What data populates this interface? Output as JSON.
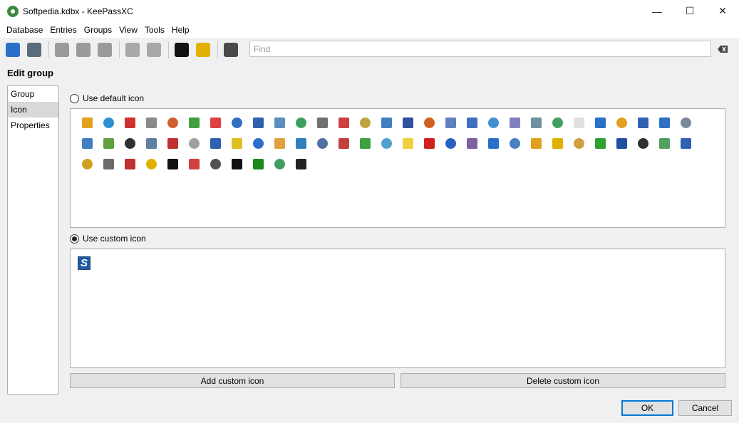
{
  "window": {
    "title": "Softpedia.kdbx - KeePassXC",
    "minimize": "—",
    "maximize": "☐",
    "close": "✕"
  },
  "menu": [
    "Database",
    "Entries",
    "Groups",
    "View",
    "Tools",
    "Help"
  ],
  "toolbar": {
    "icons": [
      {
        "name": "open-database-icon",
        "color": "#2a6fc9"
      },
      {
        "name": "save-database-icon",
        "color": "#5a6b7a"
      },
      {
        "sep": true
      },
      {
        "name": "add-entry-icon",
        "color": "#9a9a9a"
      },
      {
        "name": "edit-entry-icon",
        "color": "#9a9a9a"
      },
      {
        "name": "delete-entry-icon",
        "color": "#9a9a9a"
      },
      {
        "sep": true
      },
      {
        "name": "copy-username-icon",
        "color": "#a8a8a8"
      },
      {
        "name": "copy-password-icon",
        "color": "#a8a8a8"
      },
      {
        "sep": true
      },
      {
        "name": "password-generator-icon",
        "color": "#111111"
      },
      {
        "name": "lock-database-icon",
        "color": "#e2b100"
      },
      {
        "sep": true
      },
      {
        "name": "search-options-icon",
        "color": "#4a4a4a"
      }
    ],
    "search_placeholder": "Find"
  },
  "page_title": "Edit group",
  "sidebar": {
    "items": [
      "Group",
      "Icon",
      "Properties"
    ],
    "selected": "Icon"
  },
  "default_icon": {
    "label": "Use default icon",
    "selected": false,
    "icons": [
      "#e0a020",
      "#2f8fd0",
      "#d03030",
      "#8a8a8a",
      "#d06030",
      "#40a040",
      "#e04040",
      "#3070c0",
      "#3060b0",
      "#5a8fc0",
      "#40a060",
      "#707070",
      "#d04040",
      "#c0a040",
      "#4080c0",
      "#3050a0",
      "#d06020",
      "#6080c0",
      "#4070c0",
      "#4090d0",
      "#8080c0",
      "#7090a0",
      "#40a060",
      "#e0e0e0",
      "#2a6fc9",
      "#e0a020",
      "#3060b0",
      "#3070c0",
      "#7a8a9a",
      "#4080c0",
      "#60a040",
      "#303030",
      "#6080a0",
      "#c03030",
      "#a0a0a0",
      "#3060b0",
      "#e0c020",
      "#2a6fc9",
      "#e0a040",
      "#3080c0",
      "#5070a0",
      "#c04040",
      "#40a040",
      "#50a0d0",
      "#f0d040",
      "#d02020",
      "#2a60c0",
      "#8060a0",
      "#2a6fc9",
      "#4a80c0",
      "#e0a020",
      "#e0b000",
      "#d0a040",
      "#30a030",
      "#2050a0",
      "#303030",
      "#50a060",
      "#3060b0",
      "#d0a020",
      "#6a6a6a",
      "#c03030",
      "#e0b000",
      "#111111",
      "#d04040",
      "#505050",
      "#111111",
      "#1a8a1a",
      "#40a060",
      "#222222"
    ]
  },
  "custom_icon": {
    "label": "Use custom icon",
    "selected": true,
    "glyph": "S",
    "color": "#1e5aa8"
  },
  "buttons": {
    "add_custom": "Add custom icon",
    "delete_custom": "Delete custom icon",
    "ok": "OK",
    "cancel": "Cancel"
  }
}
